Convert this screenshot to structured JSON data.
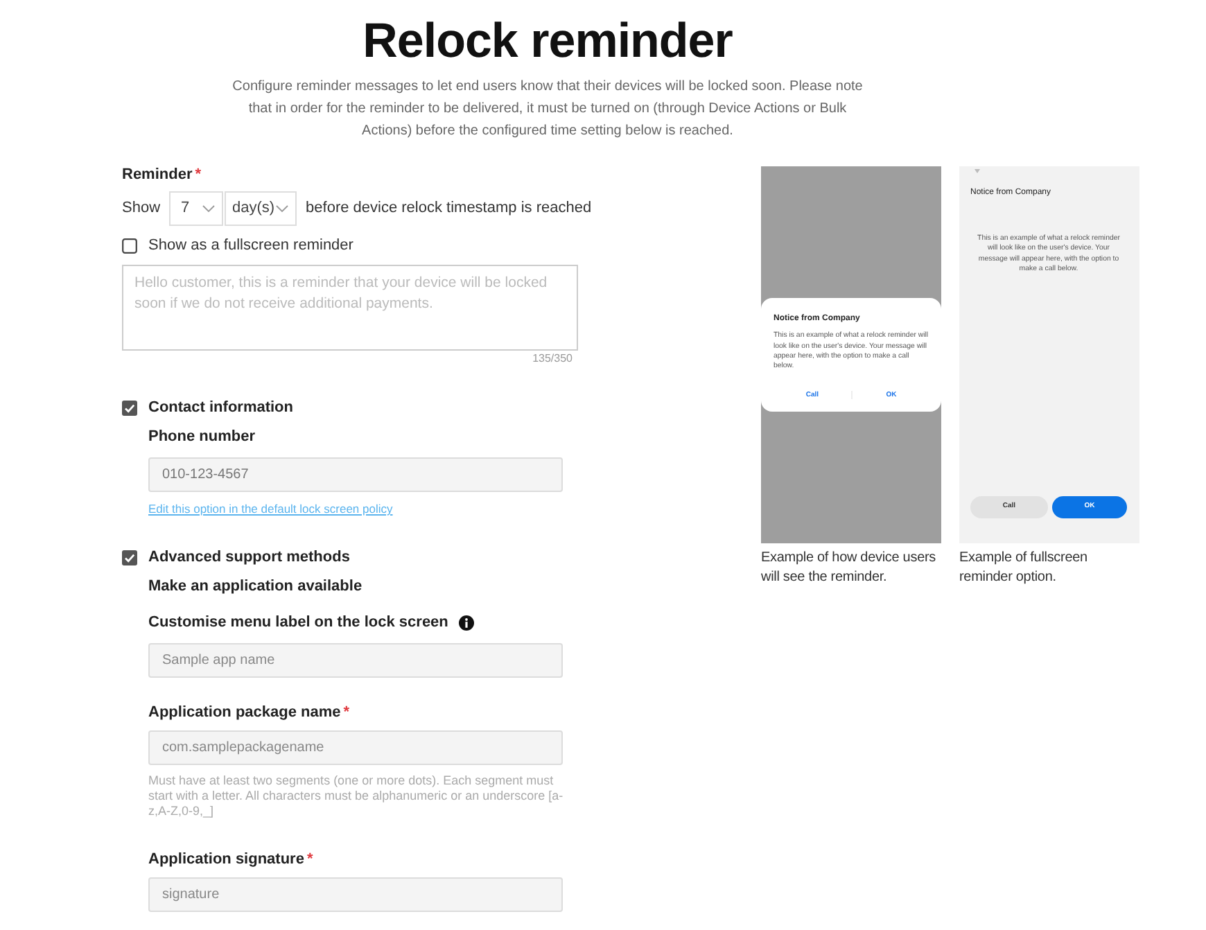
{
  "header": {
    "title": "Relock reminder",
    "description": "Configure reminder messages to let end users know that their devices will be locked soon. Please note that in order for the reminder to be delivered, it must be turned on (through Device Actions or Bulk Actions) before the configured time setting below is reached."
  },
  "reminder": {
    "label": "Reminder",
    "required_mark": "*",
    "prefix": "Show",
    "count": "7",
    "unit": "day(s)",
    "suffix": "before device relock timestamp is reached",
    "fullscreen": {
      "label": "Show as a fullscreen reminder",
      "checked": false
    },
    "message": {
      "placeholder": "Hello customer, this is a reminder that your device will be locked soon if we do not receive additional payments.",
      "counter": "135/350"
    }
  },
  "contact": {
    "label": "Contact information",
    "checked": true,
    "phone": {
      "label": "Phone number",
      "value": "010-123-4567"
    },
    "link": "Edit this option in the default lock screen policy"
  },
  "advanced": {
    "label": "Advanced support methods",
    "checked": true,
    "subtitle": "Make an application available",
    "fields": [
      {
        "label": "Customise menu label on the lock screen",
        "info": true,
        "placeholder": "Sample app name"
      },
      {
        "label": "Application package name",
        "required_mark": "*",
        "info": false,
        "placeholder": "com.samplepackagename",
        "hint": "Must have at least two segments (one or more dots). Each segment must start with a letter. All characters must be alphanumeric or an underscore [a-z,A-Z,0-9,_]"
      },
      {
        "label": "Application signature",
        "required_mark": "*",
        "info": false,
        "placeholder": "signature"
      }
    ]
  },
  "previews": [
    {
      "kind": "dialog",
      "notice_title": "Notice from Company",
      "notice_text": "This is an example of what a relock reminder will look like on the user's device. Your message will appear here, with the option to make a call below.",
      "buttons": [
        "Call",
        "OK"
      ],
      "caption": "Example of how device users will see the reminder."
    },
    {
      "kind": "fullscreen",
      "notice_title": "Notice from Company",
      "notice_text": "This is an example of what a relock reminder will look like on the user's device. Your message will appear here, with the option to make a call below.",
      "buttons": [
        {
          "label": "Call",
          "primary": false
        },
        {
          "label": "OK",
          "primary": true
        }
      ],
      "caption": "Example of fullscreen reminder option."
    }
  ]
}
